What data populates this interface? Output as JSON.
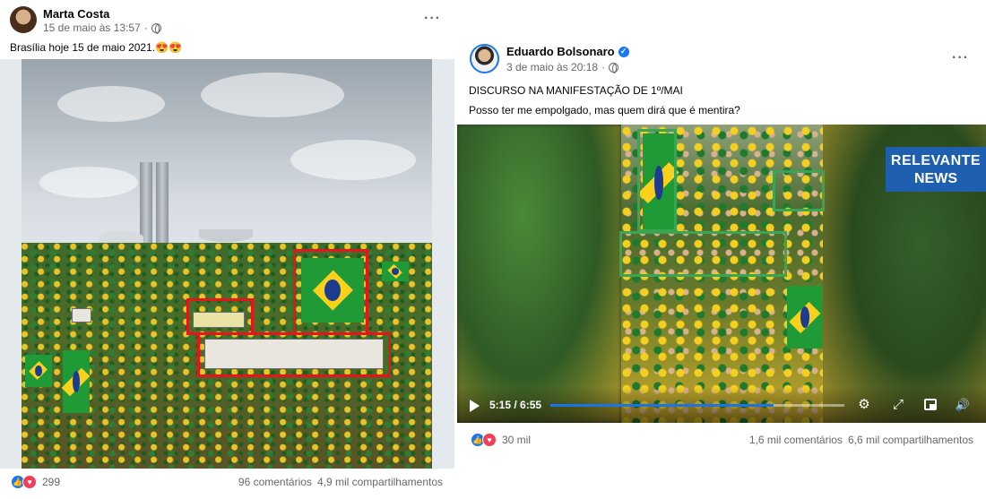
{
  "left_post": {
    "author": "Marta Costa",
    "timestamp": "15 de maio às 13:57",
    "separator": "·",
    "more": "···",
    "text": "Brasília hoje 15 de maio 2021.",
    "emoji": "😍😍",
    "reaction_count": "299",
    "comments": "96 comentários",
    "shares": "4,9 mil compartilhamentos"
  },
  "right_post": {
    "author": "Eduardo Bolsonaro",
    "verified_mark": "✓",
    "timestamp": "3 de maio às 20:18",
    "separator": "·",
    "more": "···",
    "text_line1": "DISCURSO NA MANIFESTAÇÃO DE 1º/MAI",
    "text_line2": "Posso ter me empolgado, mas quem dirá que é mentira?",
    "video": {
      "logo_line1": "RELEVANTE",
      "logo_line2": "NEWS",
      "time": "5:15 / 6:55",
      "progress_fraction": 0.76
    },
    "reaction_count": "30 mil",
    "comments": "1,6 mil comentários",
    "shares": "6,6 mil compartilhamentos"
  },
  "icons": {
    "like": "👍",
    "love": "♥",
    "settings": "⚙",
    "fullscreen": "⤢",
    "volume": "🔊"
  },
  "colors": {
    "facebook_blue": "#1877f2",
    "love_red": "#f33e58",
    "annotation_red": "#e3161b",
    "annotation_green": "#3aa552",
    "logo_blue": "#1f5fb0"
  }
}
